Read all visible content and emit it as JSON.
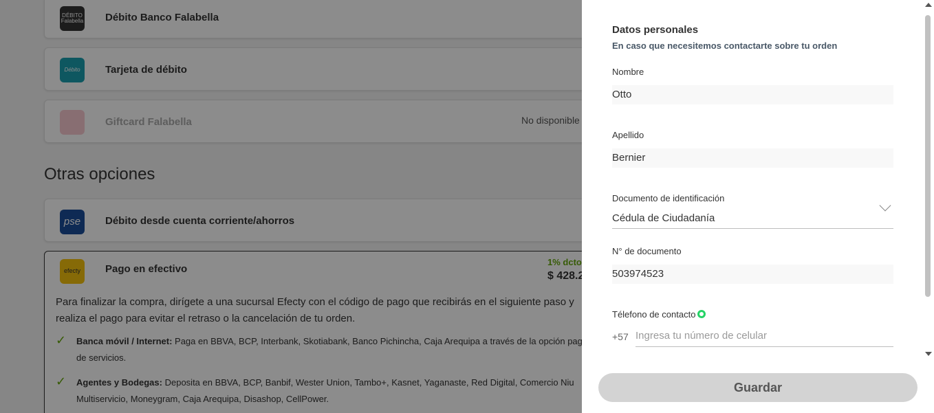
{
  "background": {
    "cards": [
      {
        "logo_text": "DÉBITO Falabella",
        "title": "Débito Banco Falabella"
      },
      {
        "logo_text": "Débito",
        "title": "Tarjeta de débito"
      },
      {
        "logo_text": "",
        "title": "Giftcard Falabella",
        "status": "No disponible"
      }
    ],
    "section_title": "Otras opciones",
    "pse": {
      "logo_text": "pse",
      "title": "Débito desde cuenta corriente/ahorros"
    },
    "efecty": {
      "logo_text": "efecty",
      "title": "Pago en efectivo",
      "discount": "1% dcto",
      "price": "$ 428.2",
      "paragraph": "Para finalizar la compra, dirígete a una sucursal Efecty con el código de pago que recibirás en el siguiente paso y realiza el pago para evitar el retraso o la cancelación de tu orden.",
      "bullets": [
        {
          "bold": "Banca móvil / Internet:",
          "text": " Paga en BBVA, BCP, Interbank, Skotiabank, Banco Pichincha, Caja Arequipa a través de la opción pago de servicios."
        },
        {
          "bold": "Agentes y Bodegas:",
          "text": " Deposita en BBVA, BCP, Banbif, Wester Union, Tambo+, Kasnet, Yaganaste, Red Digital, Comercio Niu Multiservicio, Moneygram, Caja Arequipa, Disashop, CellPower."
        }
      ]
    }
  },
  "drawer": {
    "title": "Datos personales",
    "subtitle": "En caso que necesitemos contactarte sobre tu orden",
    "nombre": {
      "label": "Nombre",
      "value": "Otto"
    },
    "apellido": {
      "label": "Apellido",
      "value": "Bernier"
    },
    "documento": {
      "label": "Documento de identificación",
      "value": "Cédula de Ciudadanía"
    },
    "numero": {
      "label": "N° de documento",
      "value": "503974523"
    },
    "telefono": {
      "label": "Télefono de contacto",
      "prefix": "+57",
      "placeholder": "Ingresa tu número de celular"
    },
    "save_label": "Guardar"
  },
  "colors": {
    "accent": "#64a70b",
    "button_bg": "#d3d3d3",
    "overlay": "#000000"
  },
  "icons": [
    "check-icon",
    "whatsapp-icon",
    "chevron-down-icon"
  ]
}
